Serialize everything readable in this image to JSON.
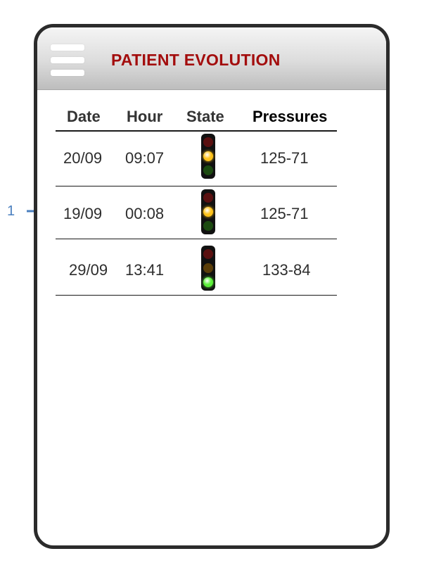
{
  "annotation": {
    "number": "1"
  },
  "header": {
    "title": "PATIENT EVOLUTION"
  },
  "table": {
    "headers": {
      "date": "Date",
      "hour": "Hour",
      "state": "State",
      "pressures": "Pressures"
    },
    "rows": [
      {
        "date": "20/09",
        "hour": "09:07",
        "state": "yellow",
        "pressures": "125-71"
      },
      {
        "date": "19/09",
        "hour": "00:08",
        "state": "yellow",
        "pressures": "125-71"
      },
      {
        "date": "29/09",
        "hour": "13:41",
        "state": "green",
        "pressures": "133-84"
      }
    ]
  },
  "colors": {
    "title": "#a30d0d",
    "annotation": "#4a7fbf",
    "lamp_red_on": "#ff2a2a",
    "lamp_red_off": "#5a1010",
    "lamp_yellow_on": "#ffc21a",
    "lamp_yellow_off": "#5a3d08",
    "lamp_green_on": "#5cf03a",
    "lamp_green_off": "#1c4a10"
  }
}
